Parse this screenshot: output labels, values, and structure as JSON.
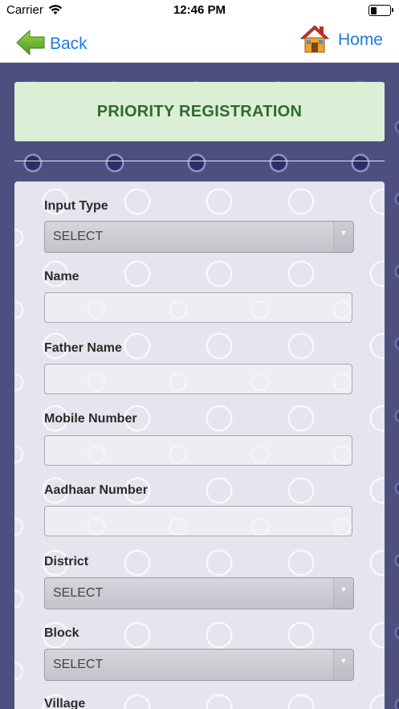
{
  "status_bar": {
    "carrier": "Carrier",
    "time": "12:46 PM"
  },
  "nav": {
    "back_label": "Back",
    "home_label": "Home",
    "back_icon": "green-left-arrow-icon",
    "home_icon": "house-icon"
  },
  "title": "PRIORITY REGISTRATION",
  "form": {
    "fields": [
      {
        "label": "Input Type",
        "type": "select",
        "value": "SELECT"
      },
      {
        "label": "Name",
        "type": "text",
        "value": ""
      },
      {
        "label": "Father Name",
        "type": "text",
        "value": ""
      },
      {
        "label": "Mobile Number",
        "type": "text",
        "value": ""
      },
      {
        "label": "Aadhaar Number",
        "type": "text",
        "value": ""
      },
      {
        "label": "District",
        "type": "select",
        "value": "SELECT"
      },
      {
        "label": "Block",
        "type": "select",
        "value": "SELECT"
      },
      {
        "label": "Village",
        "type": "select",
        "value": ""
      }
    ]
  },
  "colors": {
    "link_blue": "#1f7be0",
    "title_green": "#2f6a32",
    "title_bg": "#dcefd6",
    "background": "#4d507f"
  }
}
